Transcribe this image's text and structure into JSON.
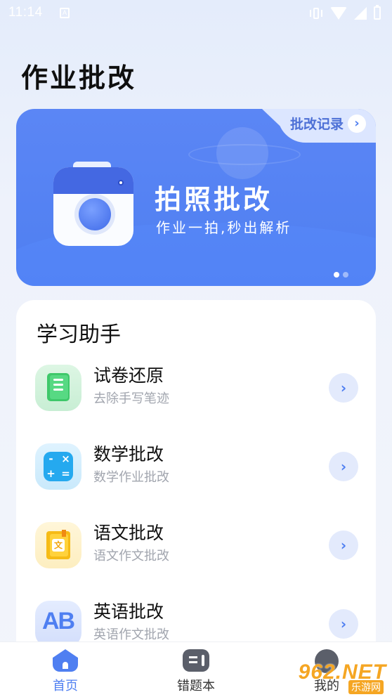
{
  "status_bar": {
    "time": "11:14",
    "sim_label": "A"
  },
  "header": {
    "title": "作业批改"
  },
  "banner": {
    "records_label": "批改记录",
    "title": "拍照批改",
    "subtitle": "作业一拍,秒出解析",
    "slides": 2,
    "active_slide": 1
  },
  "assistant": {
    "title": "学习助手",
    "items": [
      {
        "label": "试卷还原",
        "desc": "去除手写笔迹",
        "icon": "paper-restore-icon"
      },
      {
        "label": "数学批改",
        "desc": "数学作业批改",
        "icon": "calculator-icon"
      },
      {
        "label": "语文批改",
        "desc": "语文作文批改",
        "icon": "chinese-book-icon"
      },
      {
        "label": "英语批改",
        "desc": "英语作文批改",
        "icon": "ab-letters-icon"
      }
    ],
    "calc_symbols": [
      "-",
      "×",
      "+",
      "="
    ],
    "wen_char": "文",
    "ab_text": "AB"
  },
  "bottom_nav": [
    {
      "label": "首页",
      "active": true
    },
    {
      "label": "错题本",
      "active": false
    },
    {
      "label": "我的",
      "active": false
    }
  ],
  "watermark": {
    "text": "962.NET",
    "sub": "乐游网"
  },
  "colors": {
    "accent": "#4f7ff1",
    "text": "#0f0f0f",
    "muted": "#a1a5ae"
  }
}
